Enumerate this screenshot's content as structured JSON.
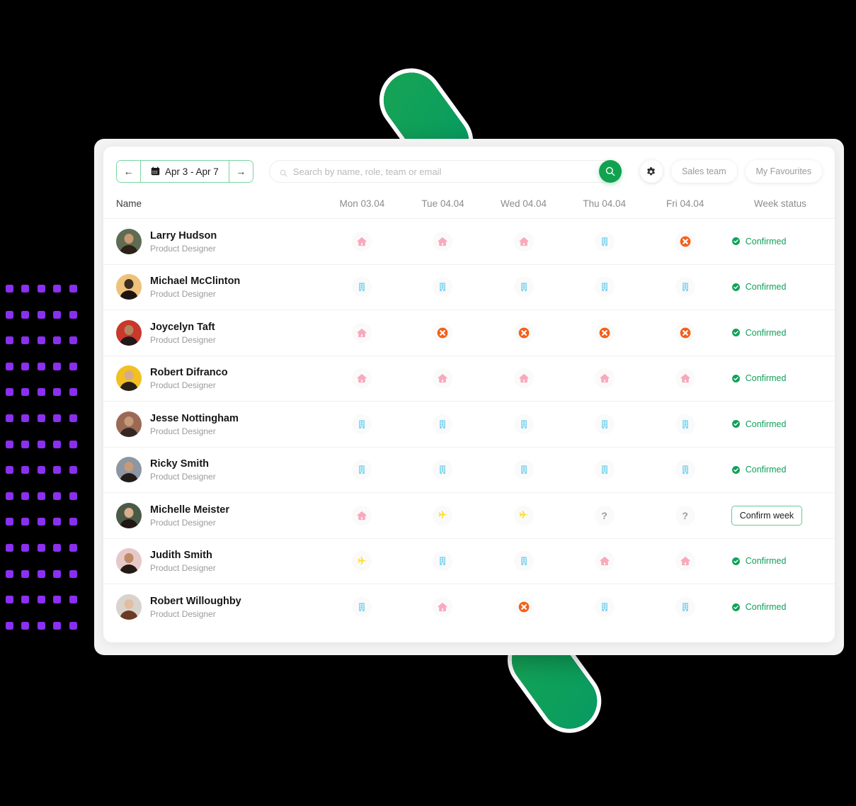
{
  "decor": {
    "dot_color": "#8B2FF0",
    "accent_green": "#10a24f",
    "background": "#000000"
  },
  "toolbar": {
    "prev_label": "←",
    "next_label": "→",
    "calendar_icon": "calendar-icon",
    "date_range": "Apr 3 - Apr 7",
    "search_placeholder": "Search by name, role, team or email",
    "search_value": "",
    "search_button_icon": "search-icon",
    "settings_icon": "gear-icon",
    "filters": [
      {
        "label": "Sales team"
      },
      {
        "label": "My Favourites"
      }
    ]
  },
  "table": {
    "headers": {
      "name": "Name",
      "days": [
        "Mon 03.04",
        "Tue 04.04",
        "Wed 04.04",
        "Thu 04.04",
        "Fri 04.04"
      ],
      "status": "Week status"
    },
    "status_labels": {
      "confirmed": "Confirmed",
      "confirm_week": "Confirm week"
    },
    "icon_legend": {
      "home": {
        "name": "home-icon",
        "color": "#f9a8bd",
        "meaning": "Working from home"
      },
      "office": {
        "name": "office-building-icon",
        "color": "#8bd8ef",
        "meaning": "In office"
      },
      "absent": {
        "name": "absent-x-circle-icon",
        "color": "#f4601a",
        "meaning": "Absent"
      },
      "travel": {
        "name": "airplane-icon",
        "color": "#fbe13c",
        "meaning": "Travelling"
      },
      "unknown": {
        "name": "question-mark-icon",
        "color": "#9b9b9b",
        "meaning": "Not set"
      }
    },
    "rows": [
      {
        "name": "Larry Hudson",
        "role": "Product Designer",
        "avatar": {
          "bg": "#5f6b52",
          "skin": "#c79a72",
          "hair": "#2b2118"
        },
        "days": [
          "home",
          "home",
          "home",
          "office",
          "absent"
        ],
        "status": "confirmed"
      },
      {
        "name": "Michael McClinton",
        "role": "Product Designer",
        "avatar": {
          "bg": "#eec27a",
          "skin": "#3b2b22",
          "hair": "#1b1410"
        },
        "days": [
          "office",
          "office",
          "office",
          "office",
          "office"
        ],
        "status": "confirmed"
      },
      {
        "name": "Joycelyn Taft",
        "role": "Product Designer",
        "avatar": {
          "bg": "#c8382c",
          "skin": "#b5845c",
          "hair": "#20181a"
        },
        "days": [
          "home",
          "absent",
          "absent",
          "absent",
          "absent"
        ],
        "status": "confirmed"
      },
      {
        "name": "Robert Difranco",
        "role": "Product Designer",
        "avatar": {
          "bg": "#f2c020",
          "skin": "#d6ab8b",
          "hair": "#2a2018"
        },
        "days": [
          "home",
          "home",
          "home",
          "home",
          "home"
        ],
        "status": "confirmed"
      },
      {
        "name": "Jesse Nottingham",
        "role": "Product Designer",
        "avatar": {
          "bg": "#9b6a54",
          "skin": "#c49a79",
          "hair": "#342622"
        },
        "days": [
          "office",
          "office",
          "office",
          "office",
          "office"
        ],
        "status": "confirmed"
      },
      {
        "name": "Ricky Smith",
        "role": "Product Designer",
        "avatar": {
          "bg": "#8d96a3",
          "skin": "#c59b79",
          "hair": "#221c18"
        },
        "days": [
          "office",
          "office",
          "office",
          "office",
          "office"
        ],
        "status": "confirmed"
      },
      {
        "name": "Michelle Meister",
        "role": "Product Designer",
        "avatar": {
          "bg": "#4b5a46",
          "skin": "#d8ae8d",
          "hair": "#201713"
        },
        "days": [
          "home",
          "travel",
          "travel",
          "unknown",
          "unknown"
        ],
        "status": "confirm_week"
      },
      {
        "name": "Judith Smith",
        "role": "Product Designer",
        "avatar": {
          "bg": "#e7c8c8",
          "skin": "#c08a66",
          "hair": "#231a16"
        },
        "days": [
          "travel",
          "office",
          "office",
          "home",
          "home"
        ],
        "status": "confirmed"
      },
      {
        "name": "Robert Willoughby",
        "role": "Product Designer",
        "avatar": {
          "bg": "#d9d3cd",
          "skin": "#e2bda0",
          "hair": "#6a3a24"
        },
        "days": [
          "office",
          "home",
          "absent",
          "office",
          "office"
        ],
        "status": "confirmed"
      }
    ]
  }
}
